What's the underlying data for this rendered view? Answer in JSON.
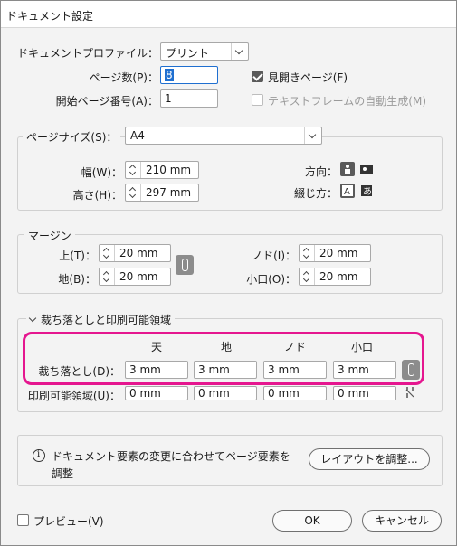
{
  "window": {
    "title": "ドキュメント設定"
  },
  "document": {
    "profile_label": "ドキュメントプロファイル：",
    "profile_value": "プリント",
    "pages_label": "ページ数(P)：",
    "pages_value": "8",
    "start_page_label": "開始ページ番号(A)：",
    "start_page_value": "1",
    "facing_pages_label": "見開きページ(F)",
    "facing_pages_checked": true,
    "primary_text_frame_label": "テキストフレームの自動生成(M)",
    "primary_text_frame_checked": false
  },
  "page_size": {
    "label": "ページサイズ(S)：",
    "value": "A4",
    "width_label": "幅(W)：",
    "width_value": "210 mm",
    "height_label": "高さ(H)：",
    "height_value": "297 mm",
    "orientation_label": "方向：",
    "binding_label": "綴じ方："
  },
  "margins": {
    "title": "マージン",
    "top_label": "上(T)：",
    "top_value": "20 mm",
    "bottom_label": "地(B)：",
    "bottom_value": "20 mm",
    "inside_label": "ノド(I)：",
    "inside_value": "20 mm",
    "outside_label": "小口(O)：",
    "outside_value": "20 mm"
  },
  "bleed_slug": {
    "title": "裁ち落としと印刷可能領域",
    "col_top": "天",
    "col_bottom": "地",
    "col_inside": "ノド",
    "col_outside": "小口",
    "bleed_label": "裁ち落とし(D)：",
    "bleed_values": [
      "3 mm",
      "3 mm",
      "3 mm",
      "3 mm"
    ],
    "slug_label": "印刷可能領域(U)：",
    "slug_values": [
      "0 mm",
      "0 mm",
      "0 mm",
      "0 mm"
    ]
  },
  "notice": {
    "text_line1": "ドキュメント要素の変更に合わせてページ要素を",
    "text_line2": "調整",
    "adjust_button": "レイアウトを調整..."
  },
  "footer": {
    "preview_label": "プレビュー(V)",
    "ok_button": "OK",
    "cancel_button": "キャンセル"
  },
  "colors": {
    "highlight": "#e5168f",
    "focus": "#1f6fd0"
  }
}
